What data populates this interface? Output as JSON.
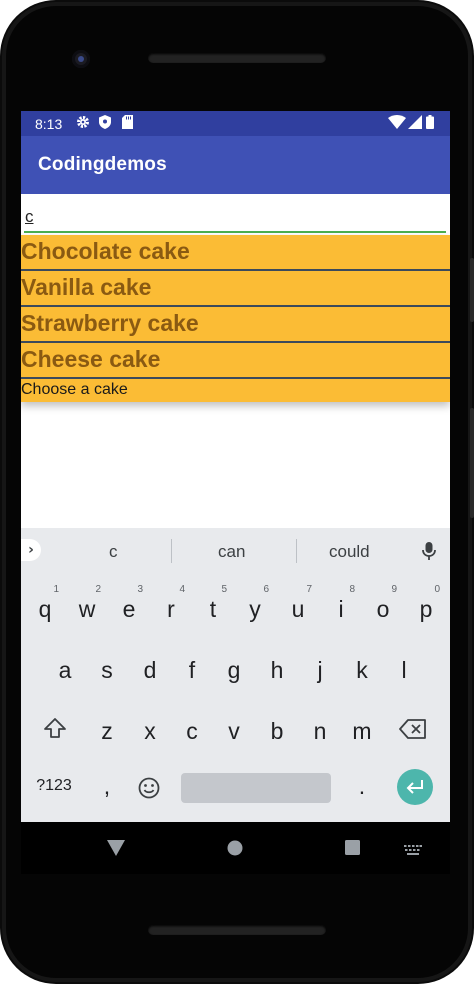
{
  "status_bar": {
    "time": "8:13",
    "left_icons": [
      "gear-icon",
      "shield-icon",
      "sd-card-icon"
    ],
    "right_icons": [
      "wifi-icon",
      "signal-icon",
      "battery-icon"
    ]
  },
  "app_bar": {
    "title": "Codingdemos"
  },
  "search": {
    "value": "c"
  },
  "dropdown": {
    "items": [
      "Chocolate cake",
      "Vanilla cake",
      "Strawberry cake",
      "Cheese cake"
    ],
    "hint": "Choose a cake"
  },
  "keyboard": {
    "suggestions": [
      "c",
      "can",
      "could"
    ],
    "row1": [
      {
        "k": "q",
        "n": "1"
      },
      {
        "k": "w",
        "n": "2"
      },
      {
        "k": "e",
        "n": "3"
      },
      {
        "k": "r",
        "n": "4"
      },
      {
        "k": "t",
        "n": "5"
      },
      {
        "k": "y",
        "n": "6"
      },
      {
        "k": "u",
        "n": "7"
      },
      {
        "k": "i",
        "n": "8"
      },
      {
        "k": "o",
        "n": "9"
      },
      {
        "k": "p",
        "n": "0"
      }
    ],
    "row2": [
      "a",
      "s",
      "d",
      "f",
      "g",
      "h",
      "j",
      "k",
      "l"
    ],
    "row3": [
      "z",
      "x",
      "c",
      "v",
      "b",
      "n",
      "m"
    ],
    "symbols_label": "?123",
    "comma": ",",
    "period": "."
  },
  "colors": {
    "status_bar": "#303f9f",
    "app_bar": "#3f51b5",
    "dropdown_bg": "#fbbc35",
    "dropdown_text": "#8a5a12",
    "enter_key": "#4db6ac",
    "field_underline": "#4caf50"
  }
}
